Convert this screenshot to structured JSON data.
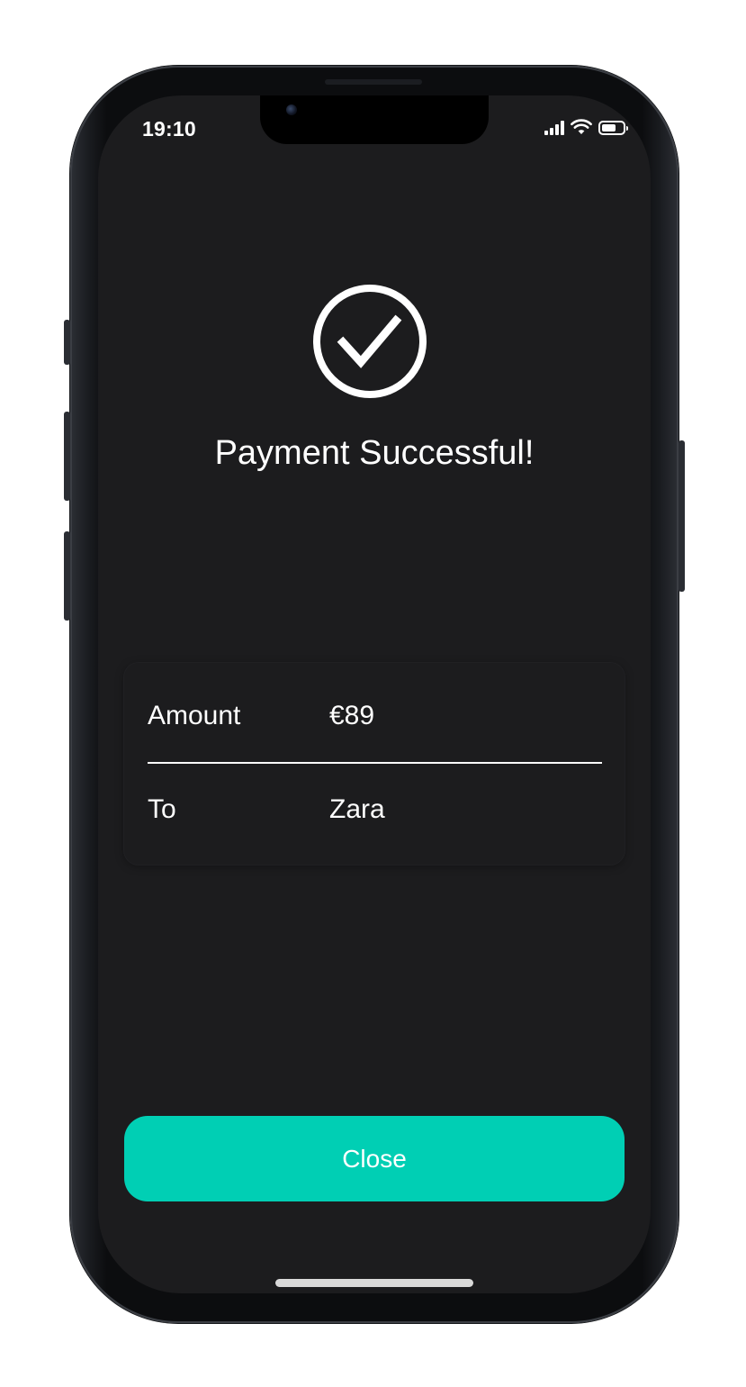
{
  "status_bar": {
    "time": "19:10",
    "battery_level": 0.7
  },
  "icons": {
    "success": "checkmark-circle-icon",
    "signal": "cellular-signal-icon",
    "wifi": "wifi-icon",
    "battery": "battery-icon"
  },
  "main": {
    "title": "Payment Successful!"
  },
  "details": {
    "rows": [
      {
        "label": "Amount",
        "value": "€89"
      },
      {
        "label": "To",
        "value": "Zara"
      }
    ]
  },
  "actions": {
    "close_label": "Close"
  },
  "colors": {
    "background": "#1c1c1e",
    "accent": "#00cfb4",
    "text": "#ffffff"
  }
}
